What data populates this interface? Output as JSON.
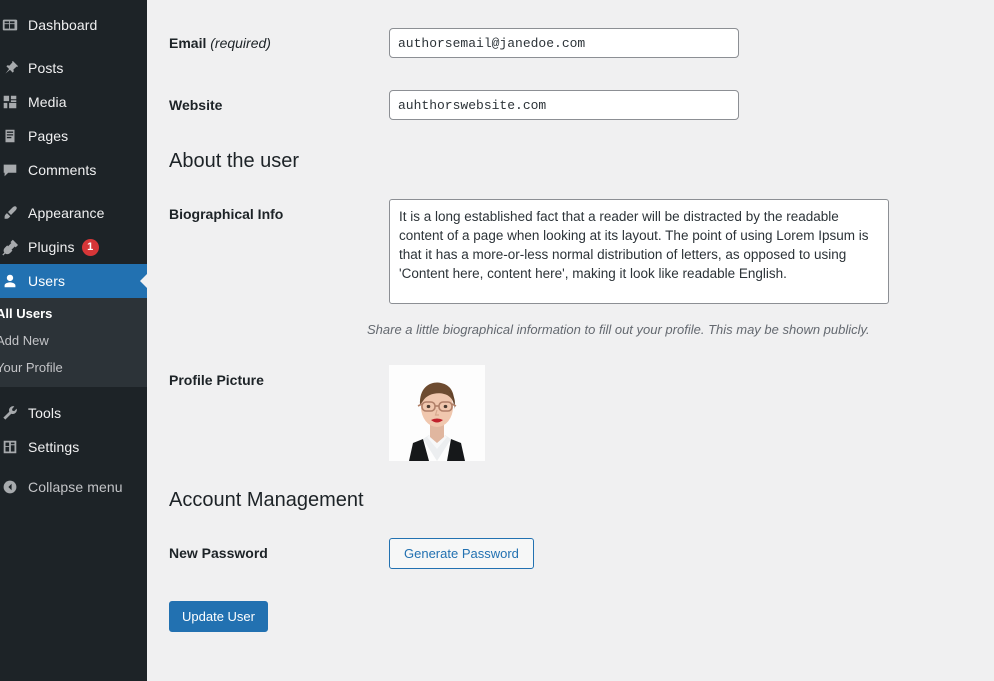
{
  "colors": {
    "sidebar_bg": "#1d2327",
    "submenu_bg": "#2c3338",
    "accent_blue": "#2271b1",
    "badge_red": "#d63638",
    "content_bg": "#f0f0f1"
  },
  "sidebar": {
    "items": [
      {
        "label": "Dashboard",
        "icon": "dashboard-icon",
        "active": false
      },
      {
        "label": "Posts",
        "icon": "pin-icon",
        "active": false
      },
      {
        "label": "Media",
        "icon": "media-icon",
        "active": false
      },
      {
        "label": "Pages",
        "icon": "page-icon",
        "active": false
      },
      {
        "label": "Comments",
        "icon": "comment-icon",
        "active": false
      },
      {
        "label": "Appearance",
        "icon": "paintbrush-icon",
        "active": false
      },
      {
        "label": "Plugins",
        "icon": "plug-icon",
        "active": false,
        "badge": "1"
      },
      {
        "label": "Users",
        "icon": "user-icon",
        "active": true
      },
      {
        "label": "Tools",
        "icon": "wrench-icon",
        "active": false
      },
      {
        "label": "Settings",
        "icon": "settings-icon",
        "active": false
      }
    ],
    "submenu": [
      {
        "label": "All Users",
        "current": true
      },
      {
        "label": "Add New",
        "current": false
      },
      {
        "label": "Your Profile",
        "current": false
      }
    ],
    "collapse": {
      "label": "Collapse menu",
      "icon": "collapse-icon"
    }
  },
  "form": {
    "email": {
      "label": "Email",
      "required_note": "(required)",
      "value": "authorsemail@janedoe.com"
    },
    "website": {
      "label": "Website",
      "value": "auhthorswebsite.com"
    },
    "about_heading": "About the user",
    "bio": {
      "label": "Biographical Info",
      "value": "It is a long established fact that a reader will be distracted by the readable content of a page when looking at its layout. The point of using Lorem Ipsum is that it has a more-or-less normal distribution of letters, as opposed to using 'Content here, content here', making it look like readable English.",
      "help": "Share a little biographical information to fill out your profile. This may be shown publicly."
    },
    "profile_picture": {
      "label": "Profile Picture",
      "alt": "portrait photo of a woman with short brown hair, glasses and red lipstick wearing a white shirt and dark blazer"
    },
    "account_heading": "Account Management",
    "new_password": {
      "label": "New Password",
      "button": "Generate Password"
    },
    "submit": "Update User"
  }
}
